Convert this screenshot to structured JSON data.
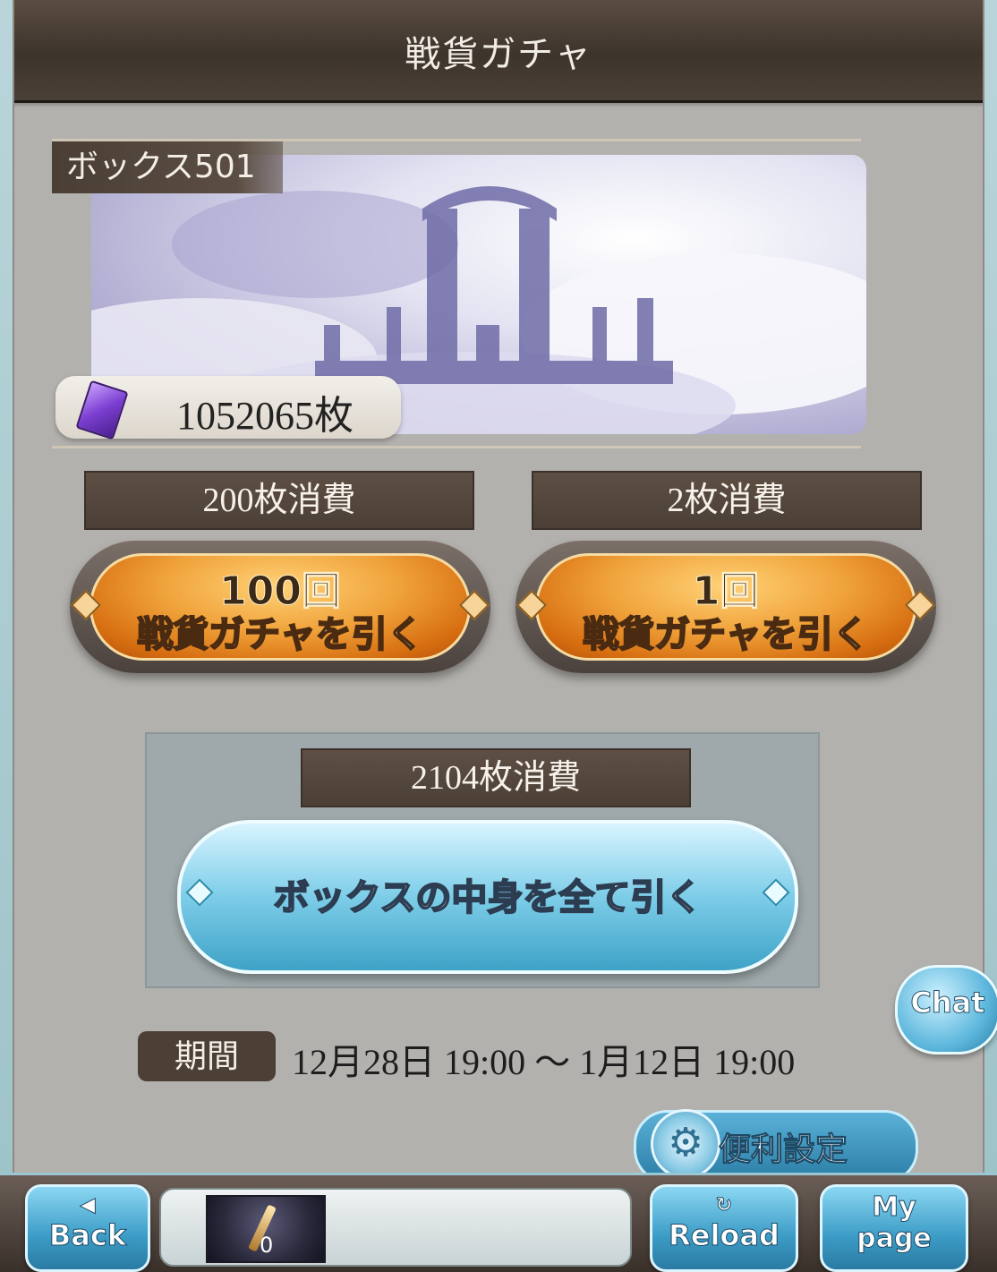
{
  "header": {
    "title": "戦貨ガチャ"
  },
  "box": {
    "label": "ボックス501"
  },
  "currency": {
    "amount": "1052065枚",
    "icon": "war-currency-ticket-icon"
  },
  "draws": [
    {
      "cost": "200枚消費",
      "line1": "100回",
      "line2": "戦貨ガチャを引く"
    },
    {
      "cost": "2枚消費",
      "line1": "1回",
      "line2": "戦貨ガチャを引く"
    }
  ],
  "draw_all": {
    "cost": "2104枚消費",
    "label": "ボックスの中身を全て引く"
  },
  "period": {
    "badge": "期間",
    "text": "12月28日 19:00 〜 1月12日 19:00"
  },
  "chat": {
    "label": "Chat"
  },
  "settings": {
    "label": "便利設定",
    "icon": "gear-icon"
  },
  "footer": {
    "back": {
      "symbol": "◀",
      "label": "Back"
    },
    "reload": {
      "symbol": "↻",
      "label": "Reload"
    },
    "mypage": {
      "line1": "My",
      "line2": "page"
    },
    "item_count": "0"
  }
}
